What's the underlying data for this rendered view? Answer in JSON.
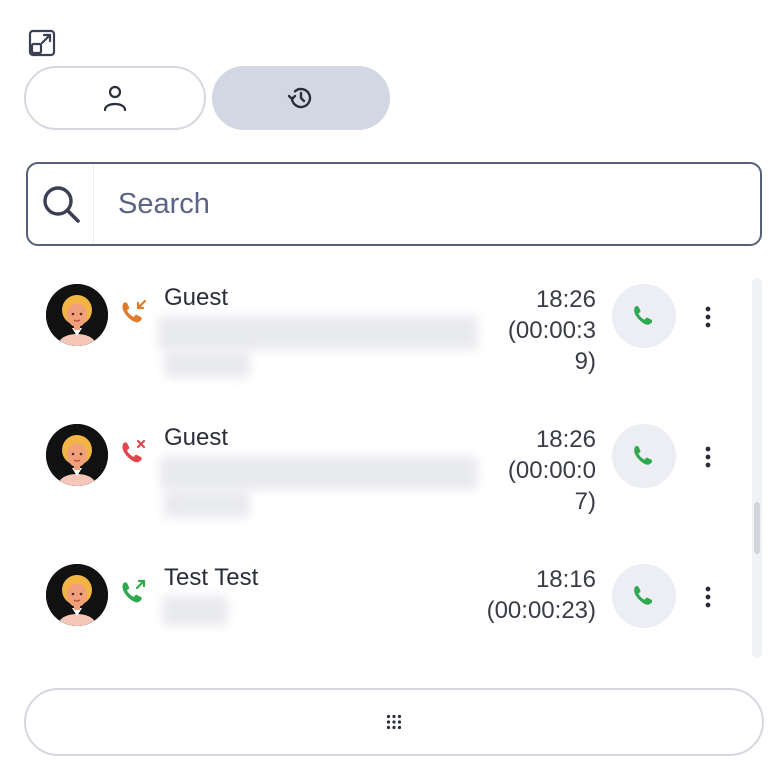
{
  "header": {
    "expand_icon": "expand-window-icon"
  },
  "tabs": [
    {
      "id": "contacts",
      "icon": "person-icon",
      "active": false
    },
    {
      "id": "history",
      "icon": "history-icon",
      "active": true
    }
  ],
  "search": {
    "placeholder": "Search",
    "value": ""
  },
  "calls": [
    {
      "name": "Guest",
      "time": "18:26",
      "duration_line1": "(00:00:3",
      "duration_line2": "9)",
      "direction": "incoming",
      "direction_color": "#e07b2c"
    },
    {
      "name": "Guest",
      "time": "18:26",
      "duration_line1": "(00:00:0",
      "duration_line2": "7)",
      "direction": "missed",
      "direction_color": "#e0474c"
    },
    {
      "name": "Test Test",
      "time": "18:16",
      "duration_line1": "(00:00:23)",
      "duration_line2": "",
      "direction": "outgoing",
      "direction_color": "#2fa84f"
    }
  ],
  "colors": {
    "call_green": "#2fa84f",
    "active_tab": "#d3d7e3",
    "search_border": "#56607c"
  },
  "footer": {
    "dialpad_icon": "dialpad-icon"
  }
}
